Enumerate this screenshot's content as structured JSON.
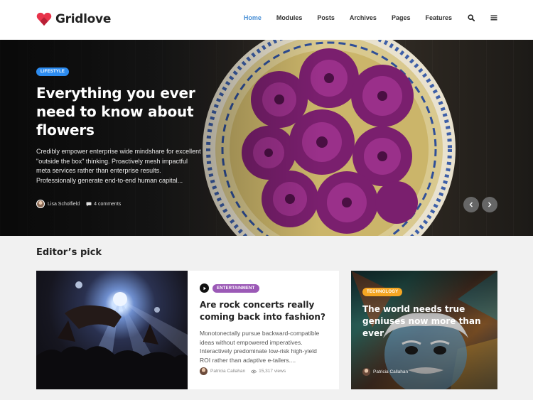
{
  "site": {
    "name": "Gridlove"
  },
  "nav": {
    "items": [
      {
        "label": "Home",
        "active": true
      },
      {
        "label": "Modules",
        "active": false
      },
      {
        "label": "Posts",
        "active": false
      },
      {
        "label": "Archives",
        "active": false
      },
      {
        "label": "Pages",
        "active": false
      },
      {
        "label": "Features",
        "active": false
      }
    ],
    "icons": [
      "search-icon",
      "menu-icon"
    ]
  },
  "hero": {
    "category": "Lifestyle",
    "title": "Everything you ever need to know about flowers",
    "excerpt": "Credibly empower enterprise wide mindshare for excellent \"outside the box\" thinking. Proactively mesh impactful meta services rather than enterprise results. Professionally generate end-to-end human capital...",
    "author": "Lisa Scholfield",
    "comments": "4 comments"
  },
  "editors_pick": {
    "heading": "Editor’s pick",
    "main_card": {
      "category": "Entertainment",
      "title": "Are rock concerts really coming back into fashion?",
      "excerpt": "Monotonectally pursue backward-compatible ideas without empowered imperatives. Interactively predominate low-risk high-yield ROI rather than adaptive e-tailers....",
      "author": "Patricia Callahan",
      "views": "15,317 views"
    },
    "side_card": {
      "category": "Technology",
      "title": "The world needs true geniuses now more than ever",
      "author": "Patricia Callahan"
    }
  },
  "colors": {
    "accent": "#4a90d6",
    "brand": "#e8334a",
    "badge_lifestyle": "#2d8cf0",
    "badge_entertainment": "#9b59b6",
    "badge_technology": "#f5a623"
  }
}
